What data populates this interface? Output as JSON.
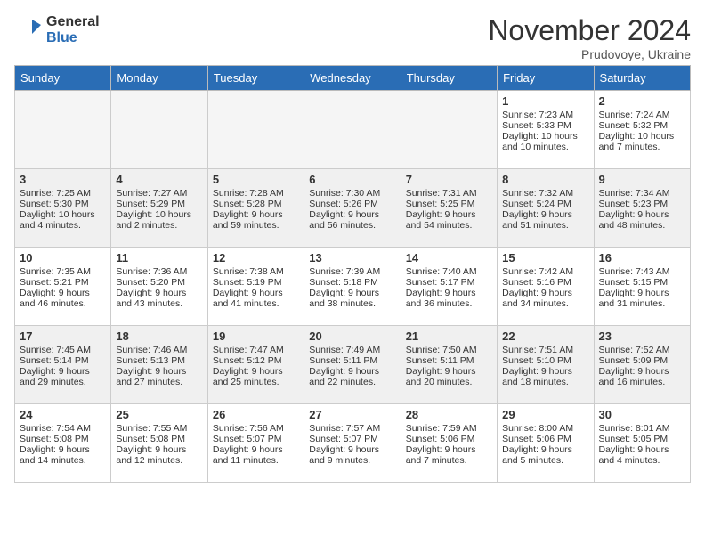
{
  "header": {
    "logo_line1": "General",
    "logo_line2": "Blue",
    "month_title": "November 2024",
    "location": "Prudovoye, Ukraine"
  },
  "weekdays": [
    "Sunday",
    "Monday",
    "Tuesday",
    "Wednesday",
    "Thursday",
    "Friday",
    "Saturday"
  ],
  "weeks": [
    [
      {
        "day": "",
        "info": ""
      },
      {
        "day": "",
        "info": ""
      },
      {
        "day": "",
        "info": ""
      },
      {
        "day": "",
        "info": ""
      },
      {
        "day": "",
        "info": ""
      },
      {
        "day": "1",
        "info": "Sunrise: 7:23 AM\nSunset: 5:33 PM\nDaylight: 10 hours and 10 minutes."
      },
      {
        "day": "2",
        "info": "Sunrise: 7:24 AM\nSunset: 5:32 PM\nDaylight: 10 hours and 7 minutes."
      }
    ],
    [
      {
        "day": "3",
        "info": "Sunrise: 7:25 AM\nSunset: 5:30 PM\nDaylight: 10 hours and 4 minutes."
      },
      {
        "day": "4",
        "info": "Sunrise: 7:27 AM\nSunset: 5:29 PM\nDaylight: 10 hours and 2 minutes."
      },
      {
        "day": "5",
        "info": "Sunrise: 7:28 AM\nSunset: 5:28 PM\nDaylight: 9 hours and 59 minutes."
      },
      {
        "day": "6",
        "info": "Sunrise: 7:30 AM\nSunset: 5:26 PM\nDaylight: 9 hours and 56 minutes."
      },
      {
        "day": "7",
        "info": "Sunrise: 7:31 AM\nSunset: 5:25 PM\nDaylight: 9 hours and 54 minutes."
      },
      {
        "day": "8",
        "info": "Sunrise: 7:32 AM\nSunset: 5:24 PM\nDaylight: 9 hours and 51 minutes."
      },
      {
        "day": "9",
        "info": "Sunrise: 7:34 AM\nSunset: 5:23 PM\nDaylight: 9 hours and 48 minutes."
      }
    ],
    [
      {
        "day": "10",
        "info": "Sunrise: 7:35 AM\nSunset: 5:21 PM\nDaylight: 9 hours and 46 minutes."
      },
      {
        "day": "11",
        "info": "Sunrise: 7:36 AM\nSunset: 5:20 PM\nDaylight: 9 hours and 43 minutes."
      },
      {
        "day": "12",
        "info": "Sunrise: 7:38 AM\nSunset: 5:19 PM\nDaylight: 9 hours and 41 minutes."
      },
      {
        "day": "13",
        "info": "Sunrise: 7:39 AM\nSunset: 5:18 PM\nDaylight: 9 hours and 38 minutes."
      },
      {
        "day": "14",
        "info": "Sunrise: 7:40 AM\nSunset: 5:17 PM\nDaylight: 9 hours and 36 minutes."
      },
      {
        "day": "15",
        "info": "Sunrise: 7:42 AM\nSunset: 5:16 PM\nDaylight: 9 hours and 34 minutes."
      },
      {
        "day": "16",
        "info": "Sunrise: 7:43 AM\nSunset: 5:15 PM\nDaylight: 9 hours and 31 minutes."
      }
    ],
    [
      {
        "day": "17",
        "info": "Sunrise: 7:45 AM\nSunset: 5:14 PM\nDaylight: 9 hours and 29 minutes."
      },
      {
        "day": "18",
        "info": "Sunrise: 7:46 AM\nSunset: 5:13 PM\nDaylight: 9 hours and 27 minutes."
      },
      {
        "day": "19",
        "info": "Sunrise: 7:47 AM\nSunset: 5:12 PM\nDaylight: 9 hours and 25 minutes."
      },
      {
        "day": "20",
        "info": "Sunrise: 7:49 AM\nSunset: 5:11 PM\nDaylight: 9 hours and 22 minutes."
      },
      {
        "day": "21",
        "info": "Sunrise: 7:50 AM\nSunset: 5:11 PM\nDaylight: 9 hours and 20 minutes."
      },
      {
        "day": "22",
        "info": "Sunrise: 7:51 AM\nSunset: 5:10 PM\nDaylight: 9 hours and 18 minutes."
      },
      {
        "day": "23",
        "info": "Sunrise: 7:52 AM\nSunset: 5:09 PM\nDaylight: 9 hours and 16 minutes."
      }
    ],
    [
      {
        "day": "24",
        "info": "Sunrise: 7:54 AM\nSunset: 5:08 PM\nDaylight: 9 hours and 14 minutes."
      },
      {
        "day": "25",
        "info": "Sunrise: 7:55 AM\nSunset: 5:08 PM\nDaylight: 9 hours and 12 minutes."
      },
      {
        "day": "26",
        "info": "Sunrise: 7:56 AM\nSunset: 5:07 PM\nDaylight: 9 hours and 11 minutes."
      },
      {
        "day": "27",
        "info": "Sunrise: 7:57 AM\nSunset: 5:07 PM\nDaylight: 9 hours and 9 minutes."
      },
      {
        "day": "28",
        "info": "Sunrise: 7:59 AM\nSunset: 5:06 PM\nDaylight: 9 hours and 7 minutes."
      },
      {
        "day": "29",
        "info": "Sunrise: 8:00 AM\nSunset: 5:06 PM\nDaylight: 9 hours and 5 minutes."
      },
      {
        "day": "30",
        "info": "Sunrise: 8:01 AM\nSunset: 5:05 PM\nDaylight: 9 hours and 4 minutes."
      }
    ]
  ]
}
